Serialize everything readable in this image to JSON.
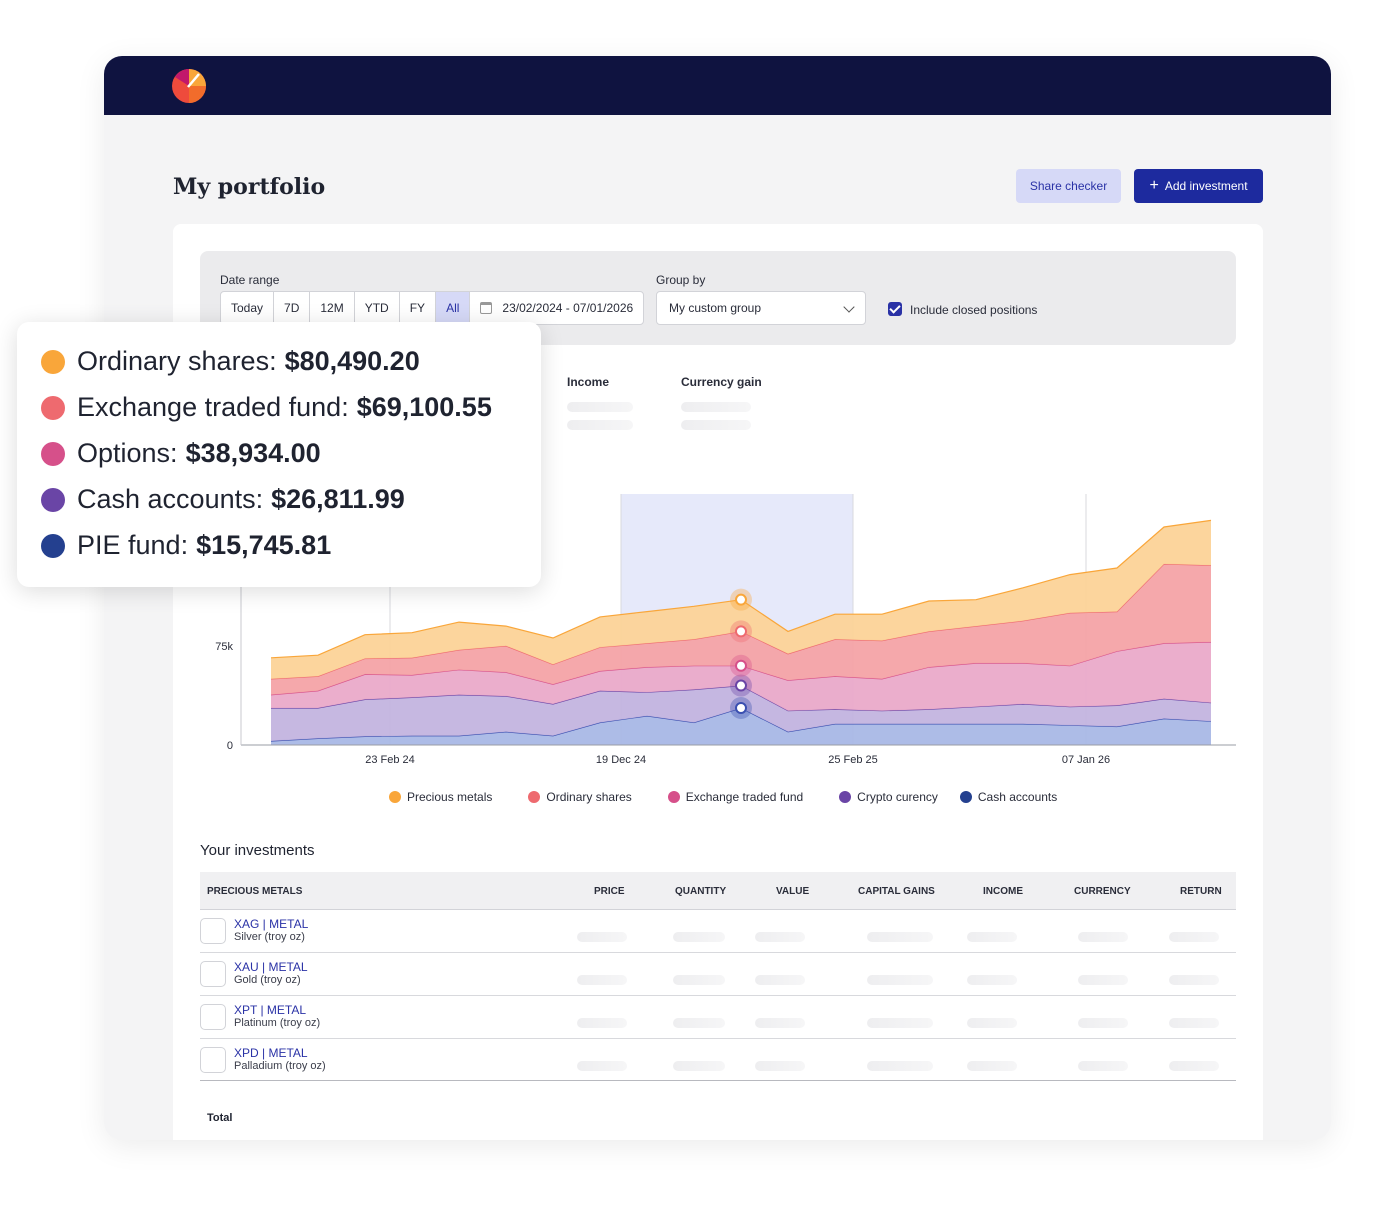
{
  "page": {
    "title": "My portfolio"
  },
  "actions": {
    "share_checker": "Share checker",
    "add_investment": "Add investment",
    "add_icon": "plus-icon"
  },
  "filters": {
    "date_range_label": "Date range",
    "ranges": [
      "Today",
      "7D",
      "12M",
      "YTD",
      "FY",
      "All"
    ],
    "active_range": "All",
    "date_value": "23/02/2024 -  07/01/2026",
    "group_by_label": "Group by",
    "group_by_value": "My custom group",
    "include_closed_label": "Include closed positions",
    "include_closed_checked": true
  },
  "stats": {
    "income_label": "Income",
    "currency_gain_label": "Currency gain"
  },
  "tooltip": {
    "items": [
      {
        "label": "Ordinary shares:",
        "value": "$80,490.20",
        "color": "#f9a63a"
      },
      {
        "label": "Exchange traded fund:",
        "value": "$69,100.55",
        "color": "#ee6a6f"
      },
      {
        "label": "Options:",
        "value": "$38,934.00",
        "color": "#d6508a"
      },
      {
        "label": "Cash accounts:",
        "value": "$26,811.99",
        "color": "#6a45a6"
      },
      {
        "label": "PIE fund:",
        "value": "$15,745.81",
        "color": "#24408f"
      }
    ]
  },
  "chart_data": {
    "type": "area",
    "stacked": true,
    "y_ticks": [
      "0",
      "75k"
    ],
    "x_ticks": [
      "23 Feb 24",
      "19 Dec 24",
      "25 Feb 25",
      "07 Jan 26"
    ],
    "ylim": [
      0,
      190000
    ],
    "grid": false,
    "legend_position": "bottom",
    "series": [
      {
        "name": "Cash accounts",
        "color": "#3a4fb0",
        "fill": "#a9b8e6",
        "values": [
          3000,
          5000,
          6500,
          7000,
          7000,
          10000,
          7000,
          17000,
          22000,
          17000,
          28000,
          10000,
          16000,
          16000,
          16000,
          16000,
          16000,
          15000,
          14000,
          20000,
          18000
        ]
      },
      {
        "name": "Crypto curency",
        "color": "#6a45a6",
        "fill": "#c3b4df",
        "values": [
          25000,
          23000,
          28000,
          29000,
          31000,
          27000,
          24000,
          24000,
          18000,
          25000,
          17000,
          16000,
          11000,
          10000,
          11000,
          13000,
          15000,
          14000,
          16000,
          15000,
          14000
        ]
      },
      {
        "name": "Exchange traded fund",
        "color": "#d6508a",
        "fill": "#eaaac9",
        "values": [
          10000,
          13000,
          19000,
          17000,
          19000,
          18000,
          15000,
          15000,
          19000,
          18000,
          15000,
          23000,
          25000,
          24000,
          32000,
          33000,
          31000,
          31000,
          41000,
          42000,
          46000
        ]
      },
      {
        "name": "Ordinary shares",
        "color": "#ee6a6f",
        "fill": "#f4a3a6",
        "values": [
          12000,
          11000,
          12000,
          13000,
          15000,
          20000,
          15000,
          18000,
          18000,
          20000,
          26000,
          20000,
          28000,
          29000,
          27000,
          28000,
          32000,
          40000,
          30000,
          60000,
          58000
        ]
      },
      {
        "name": "Precious metals",
        "color": "#f9a63a",
        "fill": "#fcd398",
        "values": [
          16000,
          16000,
          18000,
          19000,
          21000,
          15000,
          20000,
          23000,
          24000,
          25000,
          24000,
          17000,
          19000,
          20000,
          23000,
          20000,
          25000,
          29000,
          33000,
          28000,
          34000
        ]
      }
    ],
    "highlight_index": 10
  },
  "investments": {
    "title": "Your investments",
    "columns": [
      "PRECIOUS METALS",
      "PRICE",
      "QUANTITY",
      "VALUE",
      "CAPITAL GAINS",
      "INCOME",
      "CURRENCY",
      "RETURN"
    ],
    "rows": [
      {
        "symbol": "XAG | METAL",
        "name": "Silver (troy oz)"
      },
      {
        "symbol": "XAU | METAL",
        "name": "Gold (troy oz)"
      },
      {
        "symbol": "XPT | METAL",
        "name": "Platinum (troy oz)"
      },
      {
        "symbol": "XPD | METAL",
        "name": "Palladium (troy oz)"
      }
    ],
    "total_label": "Total"
  }
}
